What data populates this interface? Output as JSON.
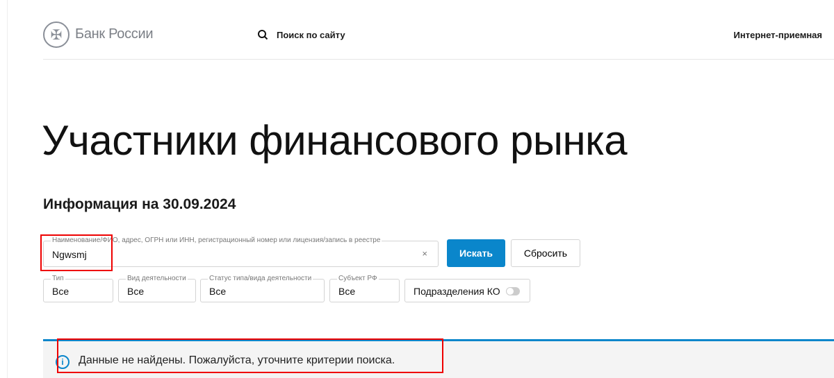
{
  "header": {
    "logo_text": "Банк России",
    "search_label": "Поиск по сайту",
    "reception_link": "Интернет-приемная"
  },
  "page": {
    "title": "Участники финансового рынка",
    "subtitle": "Информация на 30.09.2024"
  },
  "search": {
    "label": "Наименование/ФИО, адрес, ОГРН или ИНН, регистрационный номер или лицензия/запись в реестре",
    "value": "Ngwsmj",
    "clear": "×",
    "submit": "Искать",
    "reset": "Сбросить"
  },
  "filters": [
    {
      "label": "Тип",
      "value": "Все"
    },
    {
      "label": "Вид деятельности",
      "value": "Все"
    },
    {
      "label": "Статус типа/вида деятельности",
      "value": "Все"
    },
    {
      "label": "Субъект РФ",
      "value": "Все"
    }
  ],
  "toggle": {
    "label": "Подразделения КО",
    "on": false
  },
  "alert": {
    "text": "Данные не найдены. Пожалуйста, уточните критерии поиска.",
    "icon": "i"
  },
  "colors": {
    "accent": "#0A86CB",
    "highlight": "#EE0000"
  }
}
